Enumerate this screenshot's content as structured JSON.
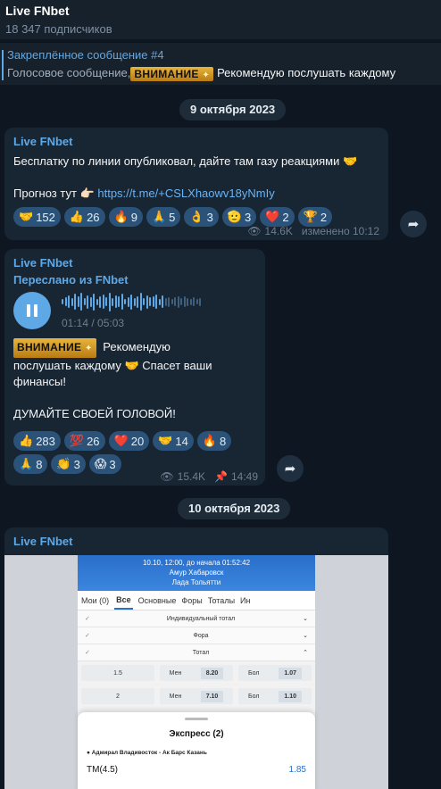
{
  "channel": {
    "title": "Live FNbet",
    "subscribers": "18 347 подписчиков"
  },
  "pinned": {
    "title": "Закреплённое сообщение #4",
    "prefix": "Голосовое сообщение,",
    "badge": "ВНИМАНИЕ",
    "text": "Рекомендую послушать каждому"
  },
  "dates": [
    "9 октября 2023",
    "10 октября 2023"
  ],
  "msg1": {
    "sender": "Live FNbet",
    "line1": "Бесплатку по линии опубликовал, дайте там газу реакциями 🤝",
    "prognoz": "Прогноз тут 👉🏻 ",
    "link": "https://t.me/+CSLXhaowv18yNmIy",
    "reactions": [
      {
        "emoji": "🤝",
        "count": "152"
      },
      {
        "emoji": "👍",
        "count": "26"
      },
      {
        "emoji": "🔥",
        "count": "9"
      },
      {
        "emoji": "🙏",
        "count": "5"
      },
      {
        "emoji": "👌",
        "count": "3"
      },
      {
        "emoji": "🫡",
        "count": "3"
      },
      {
        "emoji": "❤️",
        "count": "2"
      },
      {
        "emoji": "🏆",
        "count": "2"
      }
    ],
    "views": "14.6K",
    "edited": "изменено 10:12"
  },
  "msg2": {
    "sender": "Live FNbet",
    "forwarded": "Переслано из FNbet",
    "voice_time": "01:14 / 05:03",
    "voice_progress": 0.24,
    "badge": "ВНИМАНИЕ",
    "text1": "Рекомендую",
    "text2": "послушать каждому 🤝 Спасет ваши",
    "text3": "финансы!",
    "text4": "ДУМАЙТЕ СВОЕЙ ГОЛОВОЙ!",
    "reactions": [
      {
        "emoji": "👍",
        "count": "283"
      },
      {
        "emoji": "💯",
        "count": "26"
      },
      {
        "emoji": "❤️",
        "count": "20"
      },
      {
        "emoji": "🤝",
        "count": "14"
      },
      {
        "emoji": "🔥",
        "count": "8"
      },
      {
        "emoji": "🙏",
        "count": "8"
      },
      {
        "emoji": "👏",
        "count": "3"
      },
      {
        "emoji": "😱",
        "count": "3"
      }
    ],
    "views": "15.4K",
    "time": "14:49"
  },
  "msg3": {
    "sender": "Live FNbet",
    "shot": {
      "header": "10.10, 12:00, до начала 01:52:42",
      "team1": "Амур Хабаровск",
      "team2": "Лада Тольятти",
      "tabs": [
        "Мои (0)",
        "Все",
        "Основные",
        "Форы",
        "Тоталы",
        "Ин"
      ],
      "rows": [
        "Индивидуальный тотал",
        "Фора",
        "Тотал"
      ],
      "odds": [
        {
          "line": "1.5",
          "a": "Мен",
          "av": "8.20",
          "b": "Бол",
          "bv": "1.07"
        },
        {
          "line": "2",
          "a": "Мен",
          "av": "7.10",
          "b": "Бол",
          "bv": "1.10"
        }
      ],
      "sheet_title": "Экспресс (2)",
      "match": "Адмирал Владивосток - Ак Барс Казань",
      "bet": "ТМ(4.5)",
      "bet_odd": "1.85"
    }
  }
}
